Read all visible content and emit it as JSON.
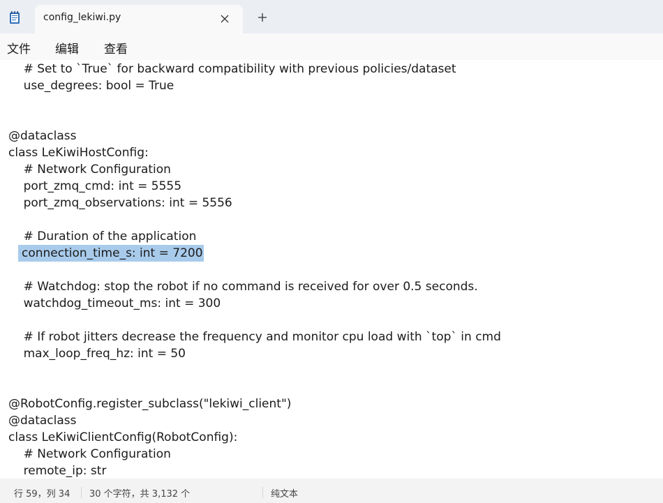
{
  "tab": {
    "title": "config_lekiwi.py"
  },
  "menu": {
    "file": "文件",
    "edit": "编辑",
    "view": "查看"
  },
  "editor": {
    "lines": [
      "    # Set to `True` for backward compatibility with previous policies/dataset",
      "    use_degrees: bool = True",
      "",
      "",
      "@dataclass",
      "class LeKiwiHostConfig:",
      "    # Network Configuration",
      "    port_zmq_cmd: int = 5555",
      "    port_zmq_observations: int = 5556",
      "",
      "    # Duration of the application",
      "    connection_time_s: int = 7200",
      "",
      "    # Watchdog: stop the robot if no command is received for over 0.5 seconds.",
      "    watchdog_timeout_ms: int = 300",
      "",
      "    # If robot jitters decrease the frequency and monitor cpu load with `top` in cmd",
      "    max_loop_freq_hz: int = 50",
      "",
      "",
      "@RobotConfig.register_subclass(\"lekiwi_client\")",
      "@dataclass",
      "class LeKiwiClientConfig(RobotConfig):",
      "    # Network Configuration",
      "    remote_ip: str"
    ],
    "selected_text": "connection_time_s: int = 7200"
  },
  "status": {
    "position": "行 59，列 34",
    "selection": "30 个字符，共 3,132 个",
    "format": "纯文本"
  },
  "colors": {
    "selection": "#a8cbeb",
    "tabbar": "#ebeef3",
    "active_tab": "#f9f9f9"
  },
  "icons": {
    "app": "notepad-icon",
    "close": "close-icon",
    "add": "plus-icon"
  }
}
